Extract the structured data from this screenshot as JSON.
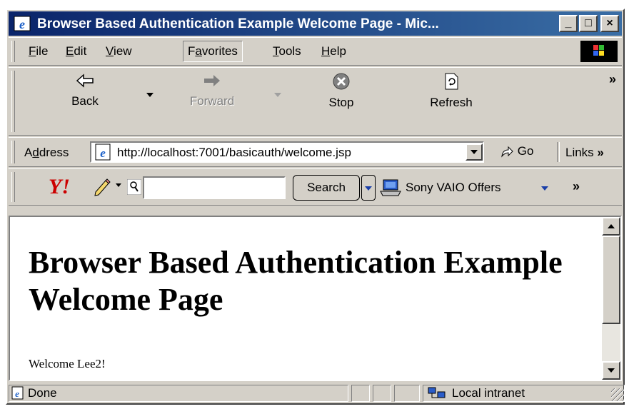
{
  "window": {
    "title": "Browser Based Authentication Example Welcome Page - Mic...",
    "controls": {
      "minimize": "_",
      "maximize": "□",
      "close": "×"
    }
  },
  "menu": {
    "items": [
      {
        "label": "File",
        "accel": "F"
      },
      {
        "label": "Edit",
        "accel": "E"
      },
      {
        "label": "View",
        "accel": "V"
      },
      {
        "label": "Favorites",
        "accel": "a"
      },
      {
        "label": "Tools",
        "accel": "T"
      },
      {
        "label": "Help",
        "accel": "H"
      }
    ]
  },
  "toolbar": {
    "back_label": "Back",
    "forward_label": "Forward",
    "stop_label": "Stop",
    "refresh_label": "Refresh",
    "overflow": "»"
  },
  "address_bar": {
    "label": "Address",
    "url": "http://localhost:7001/basicauth/welcome.jsp",
    "go_label": "Go",
    "links_label": "Links",
    "links_overflow": "»"
  },
  "yahoo_bar": {
    "search_input_value": "",
    "search_button_label": "Search",
    "offer_label": "Sony VAIO Offers",
    "overflow": "»"
  },
  "page": {
    "heading": "Browser Based Authentication Example Welcome Page",
    "welcome_text": "Welcome Lee2!"
  },
  "status": {
    "text": "Done",
    "zone": "Local intranet"
  },
  "colors": {
    "title_gradient_start": "#0a246a",
    "title_gradient_end": "#3a6ea5",
    "chrome": "#d4d0c8",
    "yahoo_red": "#cc0000"
  }
}
